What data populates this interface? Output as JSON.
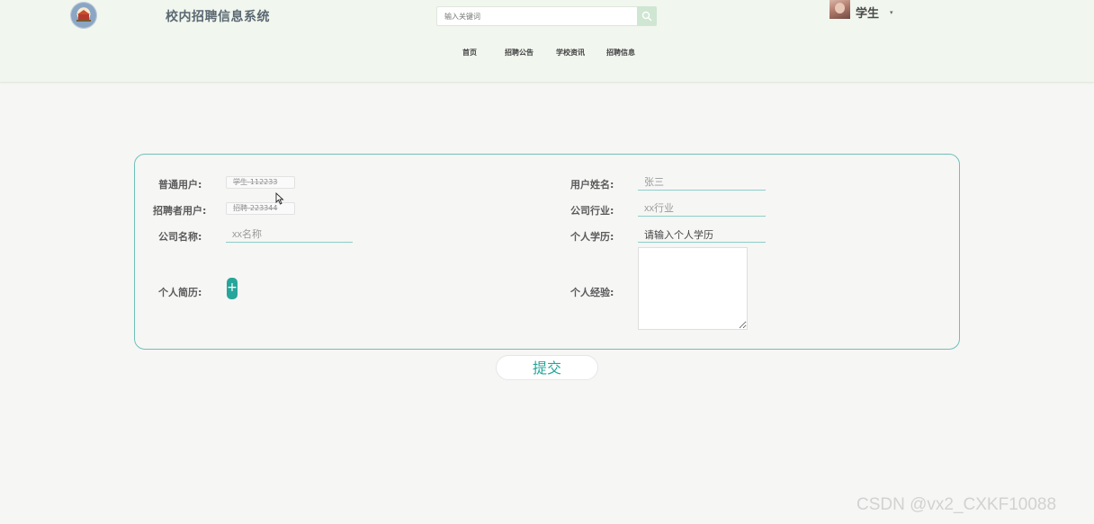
{
  "header": {
    "title": "校内招聘信息系统",
    "search_placeholder": "输入关键词",
    "nav": [
      "首页",
      "招聘公告",
      "学校资讯",
      "招聘信息"
    ],
    "user": "学生",
    "caret": "▾"
  },
  "form": {
    "normal_user": {
      "label": "普通用户:",
      "value": "学生-112233"
    },
    "recruiter_user": {
      "label": "招聘者用户:",
      "value": "招聘-223344"
    },
    "company_name": {
      "label": "公司名称:",
      "placeholder": "xx名称"
    },
    "resume": {
      "label": "个人简历:",
      "button": "+"
    },
    "user_name": {
      "label": "用户姓名:",
      "placeholder": "张三"
    },
    "industry": {
      "label": "公司行业:",
      "placeholder": "xx行业"
    },
    "education": {
      "label": "个人学历:",
      "value": "请输入个人学历"
    },
    "experience": {
      "label": "个人经验:"
    },
    "submit_label": "提交"
  },
  "watermark": "CSDN @vx2_CXKF10088",
  "colors": {
    "accent": "#26a69a",
    "border": "#6fc0b8",
    "header_bg": "#f1f6ee"
  }
}
